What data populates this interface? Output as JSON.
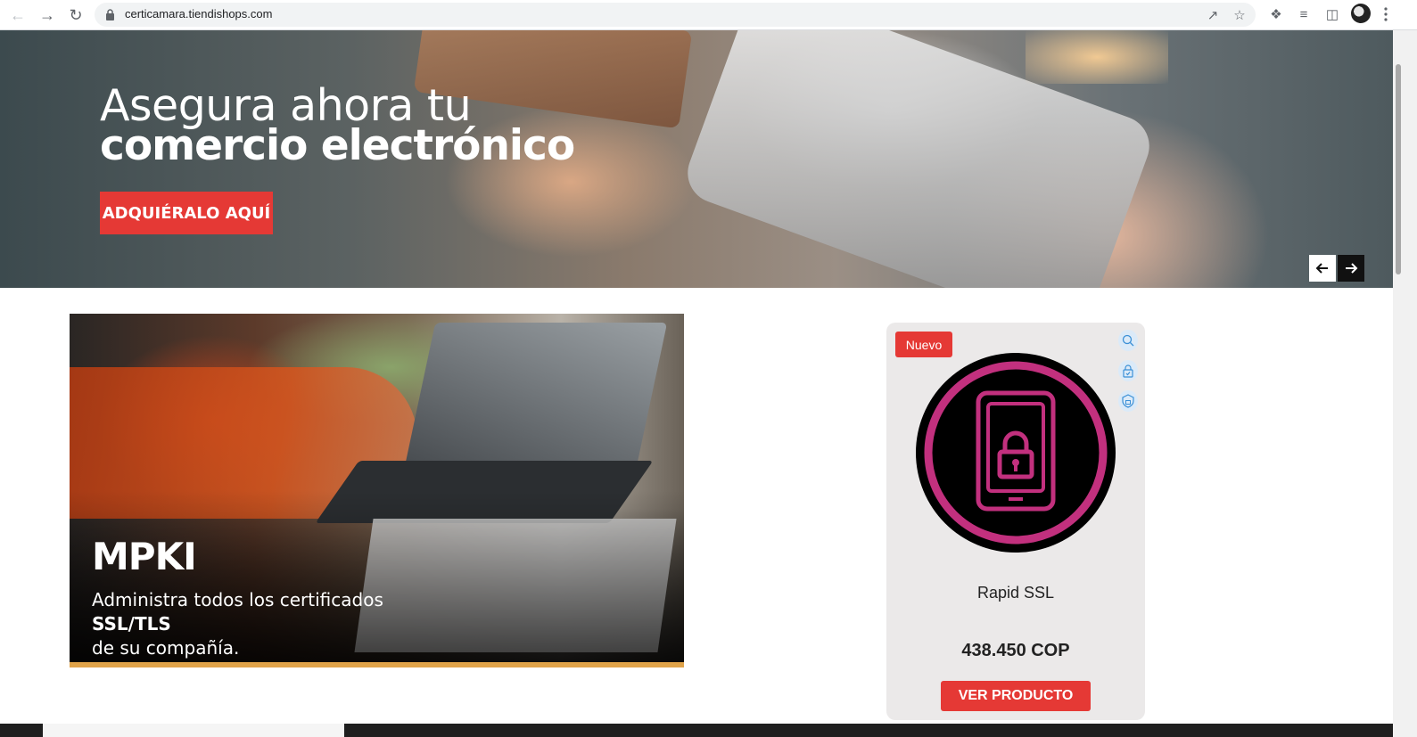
{
  "browser": {
    "url": "certicamara.tiendishops.com",
    "icons": [
      "back-icon",
      "forward-icon",
      "reload-icon",
      "lock-icon",
      "share-icon",
      "star-icon",
      "extensions-icon",
      "reading-list-icon",
      "side-panel-icon",
      "profile-avatar",
      "menu-icon"
    ]
  },
  "hero": {
    "title_line1": "Asegura ahora tu",
    "title_line2": "comercio electrónico",
    "cta_label": "ADQUIÉRALO AQUÍ",
    "prev_icon": "arrow-left-icon",
    "next_icon": "arrow-right-icon"
  },
  "mpki": {
    "title": "MPKI",
    "desc_pre": "Administra todos los certificados ",
    "desc_bold": "SSL/TLS",
    "desc_post": "de su compañía.",
    "accent_color": "#e0a349"
  },
  "product": {
    "badge": "Nuevo",
    "name": "Rapid SSL",
    "price": "438.450 COP",
    "cta_label": "VER PRODUCTO",
    "side_icons": [
      "search-shield-icon",
      "lock-check-icon",
      "lock-shield-icon"
    ]
  },
  "colors": {
    "accent_red": "#e53935",
    "product_ring": "#c2307e",
    "card_bg": "#ebe9e9"
  }
}
